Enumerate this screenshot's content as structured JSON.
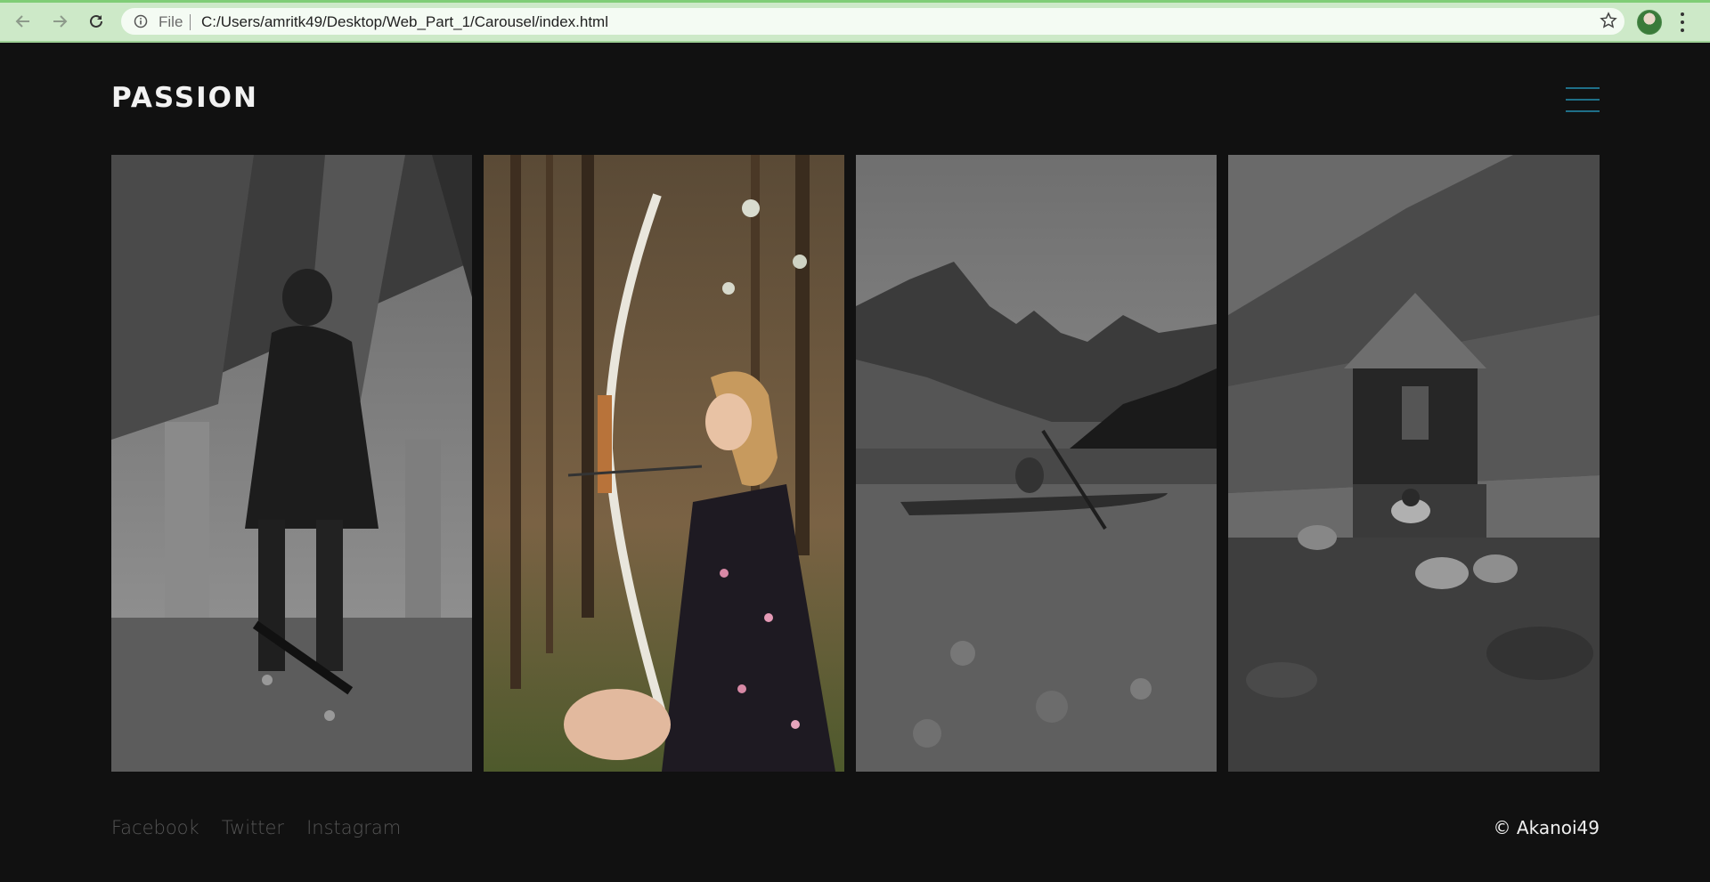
{
  "browser": {
    "file_label": "File",
    "url": "C:/Users/amritk49/Desktop/Web_Part_1/Carousel/index.html"
  },
  "header": {
    "logo": "PASSION"
  },
  "gallery": {
    "cards": [
      {
        "subject": "skateboarder under bridge"
      },
      {
        "subject": "woman with bow in forest"
      },
      {
        "subject": "kayaker on mountain lake"
      },
      {
        "subject": "person in hot spring by hut"
      }
    ]
  },
  "footer": {
    "links": [
      "Facebook",
      "Twitter",
      "Instagram"
    ],
    "copyright": "© Akanoi49"
  },
  "colors": {
    "background": "#111111",
    "chrome": "#cde9c8",
    "accent": "#1f6f88",
    "footer_link": "#555555"
  }
}
